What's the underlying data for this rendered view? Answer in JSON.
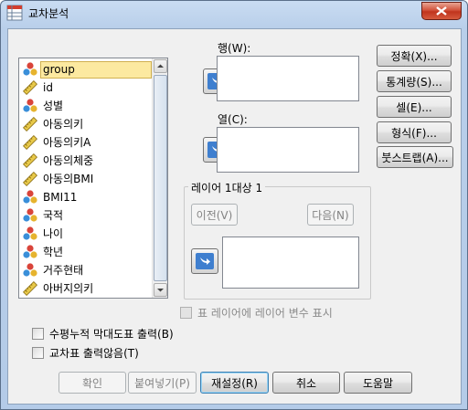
{
  "window": {
    "title": "교차분석"
  },
  "variables": [
    {
      "label": "group",
      "icon": "nominal-icon",
      "selected": true
    },
    {
      "label": "id",
      "icon": "scale-icon",
      "selected": false
    },
    {
      "label": "성별",
      "icon": "nominal-icon",
      "selected": false
    },
    {
      "label": "아동의키",
      "icon": "scale-icon",
      "selected": false
    },
    {
      "label": "아동의키A",
      "icon": "scale-icon",
      "selected": false
    },
    {
      "label": "아동의체중",
      "icon": "scale-icon",
      "selected": false
    },
    {
      "label": "아동의BMI",
      "icon": "scale-icon",
      "selected": false
    },
    {
      "label": "BMI11",
      "icon": "nominal-icon",
      "selected": false
    },
    {
      "label": "국적",
      "icon": "nominal-icon",
      "selected": false
    },
    {
      "label": "나이",
      "icon": "nominal-icon",
      "selected": false
    },
    {
      "label": "학년",
      "icon": "nominal-icon",
      "selected": false
    },
    {
      "label": "거주현태",
      "icon": "nominal-icon",
      "selected": false
    },
    {
      "label": "아버지의키",
      "icon": "scale-icon",
      "selected": false
    }
  ],
  "rows": {
    "label": "행(W):"
  },
  "columns": {
    "label": "열(C):"
  },
  "layer": {
    "title": "레이어 1대상 1",
    "prev_label": "이전(V)",
    "next_label": "다음(N)"
  },
  "side_buttons": {
    "exact": "정확(X)...",
    "statistics": "통계량(S)...",
    "cells": "셀(E)...",
    "format": "형식(F)...",
    "bootstrap": "붓스트랩(A)..."
  },
  "options": {
    "layer_display": "표 레이어에 레이어 변수 표시",
    "clustered_bar": "수평누적 막대도표 출력(B)",
    "suppress_tables": "교차표 출력않음(T)"
  },
  "bottom_buttons": {
    "ok": "확인",
    "paste": "붙여넣기(P)",
    "reset": "재설정(R)",
    "cancel": "취소",
    "help": "도움말"
  },
  "colors": {
    "accent": "#3f7fcf",
    "selection": "#fce9a0",
    "close": "#c0341e"
  }
}
